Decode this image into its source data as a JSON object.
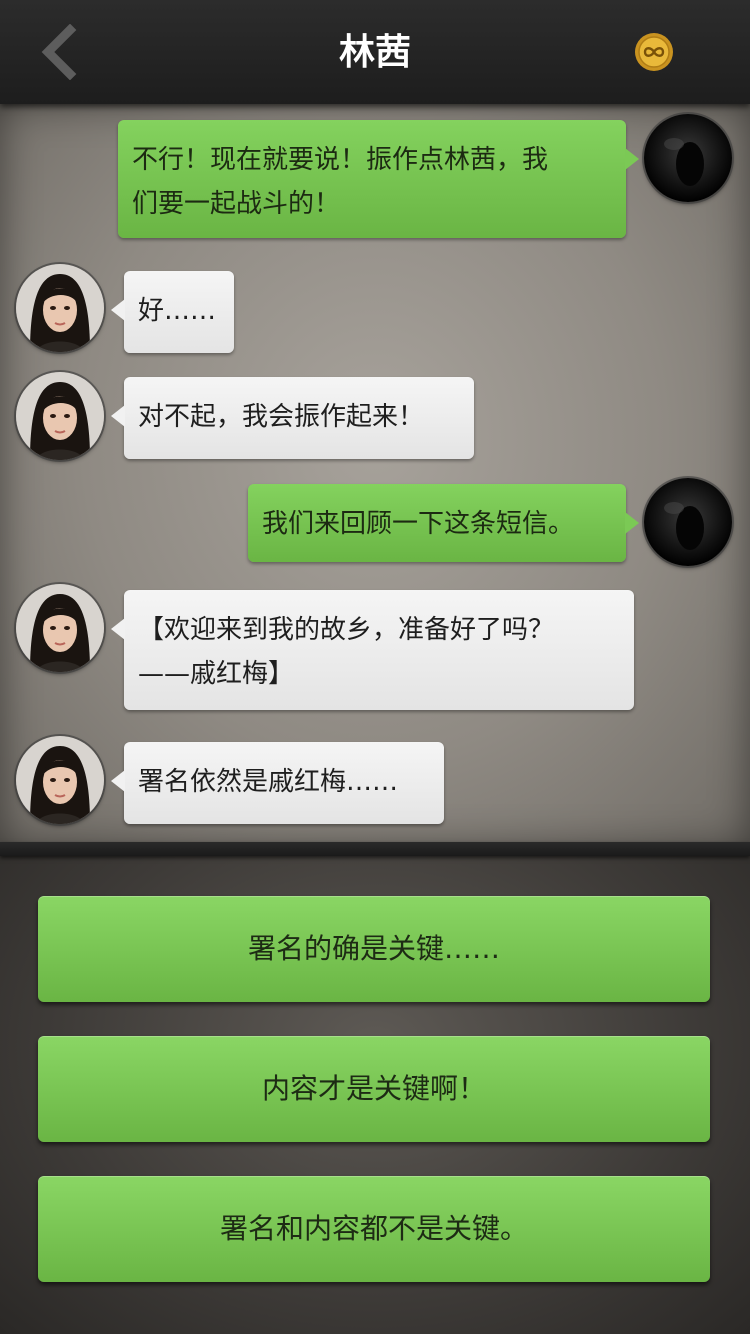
{
  "header": {
    "title": "林茜",
    "back_icon": "chevron-left-icon",
    "coin_icon": "infinity-coin-icon"
  },
  "messages": [
    {
      "from": "me",
      "text": "不行！现在就要说！振作点林茜，我\n们要一起战斗的！"
    },
    {
      "from": "them",
      "text": "好……"
    },
    {
      "from": "them",
      "text": "对不起，我会振作起来！"
    },
    {
      "from": "me",
      "text": "我们来回顾一下这条短信。"
    },
    {
      "from": "them",
      "text": "【欢迎来到我的故乡，准备好了吗？\n——戚红梅】"
    },
    {
      "from": "them",
      "text": "署名依然是戚红梅……"
    }
  ],
  "choices": [
    {
      "label": "署名的确是关键……"
    },
    {
      "label": "内容才是关键啊！"
    },
    {
      "label": "署名和内容都不是关键。"
    }
  ],
  "colors": {
    "bubble_me": "#7bc955",
    "bubble_them": "#f1f1f1",
    "choice_green": "#78c552",
    "header_bg": "#262626"
  }
}
